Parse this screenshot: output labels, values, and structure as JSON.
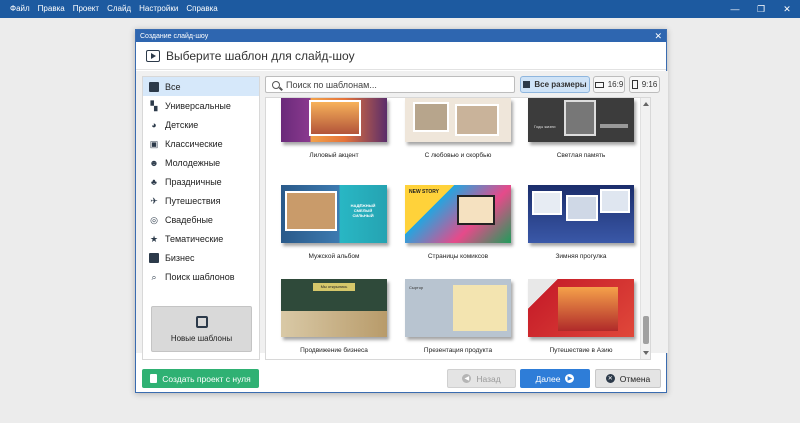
{
  "menu": [
    "Файл",
    "Правка",
    "Проект",
    "Слайд",
    "Настройки",
    "Справка"
  ],
  "dialog": {
    "title": "Создание слайд-шоу",
    "header": "Выберите шаблон для слайд-шоу"
  },
  "sidebar": {
    "items": [
      {
        "label": "Все",
        "icon": "grid-icon",
        "active": true
      },
      {
        "label": "Универсальные",
        "icon": "blocks-icon"
      },
      {
        "label": "Детские",
        "icon": "stroller-icon"
      },
      {
        "label": "Классические",
        "icon": "camera-icon"
      },
      {
        "label": "Молодежные",
        "icon": "face-icon"
      },
      {
        "label": "Праздничные",
        "icon": "balloons-icon"
      },
      {
        "label": "Путешествия",
        "icon": "plane-icon"
      },
      {
        "label": "Свадебные",
        "icon": "rings-icon"
      },
      {
        "label": "Тематические",
        "icon": "star-icon"
      },
      {
        "label": "Бизнес",
        "icon": "briefcase-icon"
      },
      {
        "label": "Поиск шаблонов",
        "icon": "search-icon"
      }
    ],
    "new_templates_label": "Новые шаблоны"
  },
  "search": {
    "placeholder": "Поиск по шаблонам..."
  },
  "filters": {
    "all": "Все размеры",
    "wide": "16:9",
    "tall": "9:16"
  },
  "templates": [
    {
      "label": "Лиловый акцент",
      "thumb_text": ""
    },
    {
      "label": "С любовью и скорбью",
      "thumb_text": ""
    },
    {
      "label": "Светлая память",
      "thumb_text": "Годы жизни"
    },
    {
      "label": "Мужской альбом",
      "thumb_text": "НАДЁЖНЫЙ СМЕЛЫЙ СИЛЬНЫЙ"
    },
    {
      "label": "Страницы комиксов",
      "thumb_text": "NEW STORY"
    },
    {
      "label": "Зимняя прогулка",
      "thumb_text": ""
    },
    {
      "label": "Продвижение бизнеса",
      "thumb_text": "Мы открылись"
    },
    {
      "label": "Презентация продукта",
      "thumb_text": "Сыртор"
    },
    {
      "label": "Путешествие в Азию",
      "thumb_text": ""
    }
  ],
  "buttons": {
    "create": "Создать проект с нуля",
    "back": "Назад",
    "next": "Далее",
    "cancel": "Отмена"
  },
  "colors": {
    "accent": "#2e7dd8",
    "create": "#2fb173",
    "titlebar": "#1d5aa0"
  }
}
